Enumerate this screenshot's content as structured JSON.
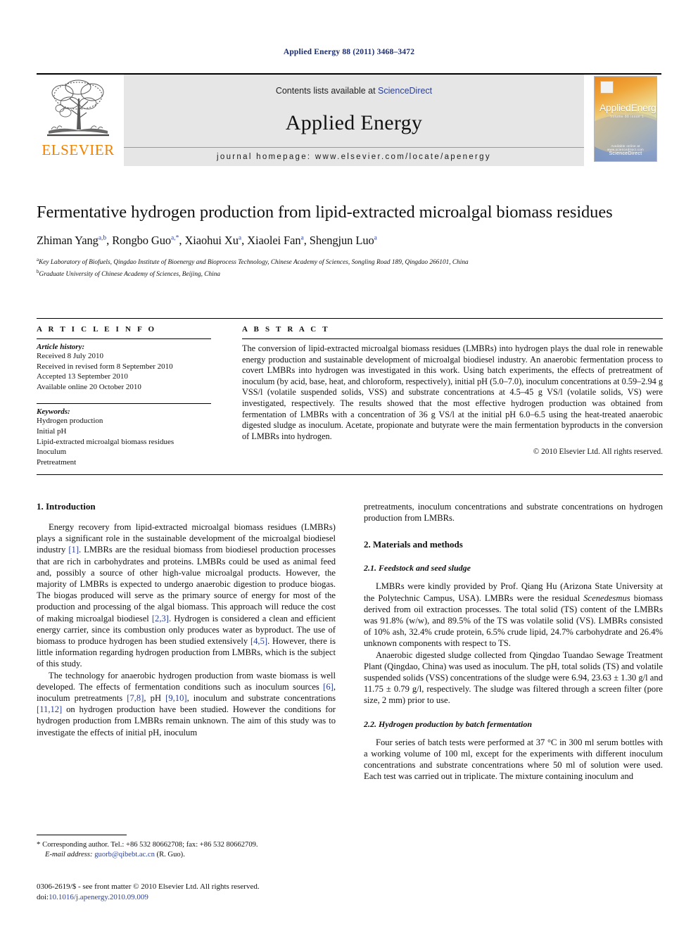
{
  "running_head": "Applied Energy 88 (2011) 3468–3472",
  "masthead": {
    "publisher_name": "ELSEVIER",
    "contents_prefix": "Contents lists available at ",
    "sciencedirect": "ScienceDirect",
    "journal_title": "Applied Energy",
    "homepage": "journal homepage: www.elsevier.com/locate/apenergy",
    "cover": {
      "title_part1": "Applied",
      "title_part2": "Energy",
      "subtitle": "Volume 88  Issue 1",
      "footer_small": "Available online at www.sciencedirect.com",
      "footer_big": "ScienceDirect"
    }
  },
  "article": {
    "title": "Fermentative hydrogen production from lipid-extracted microalgal biomass residues",
    "authors": [
      {
        "name": "Zhiman Yang",
        "sup": "a,b",
        "sep": ", "
      },
      {
        "name": "Rongbo Guo",
        "sup": "a,*",
        "sep": ", "
      },
      {
        "name": "Xiaohui Xu",
        "sup": "a",
        "sep": ", "
      },
      {
        "name": "Xiaolei Fan",
        "sup": "a",
        "sep": ", "
      },
      {
        "name": "Shengjun Luo",
        "sup": "a",
        "sep": ""
      }
    ],
    "affiliations": [
      {
        "marker": "a",
        "text": "Key Laboratory of Biofuels, Qingdao Institute of Bioenergy and Bioprocess Technology, Chinese Academy of Sciences, Songling Road 189, Qingdao 266101, China"
      },
      {
        "marker": "b",
        "text": "Graduate University of Chinese Academy of Sciences, Beijing, China"
      }
    ]
  },
  "article_info": {
    "heading": "A R T I C L E   I N F O",
    "history_label": "Article history:",
    "history": [
      "Received 8 July 2010",
      "Received in revised form 8 September 2010",
      "Accepted 13 September 2010",
      "Available online 20 October 2010"
    ],
    "keywords_label": "Keywords:",
    "keywords": [
      "Hydrogen production",
      "Initial pH",
      "Lipid-extracted microalgal biomass residues",
      "Inoculum",
      "Pretreatment"
    ]
  },
  "abstract": {
    "heading": "A B S T R A C T",
    "text": "The conversion of lipid-extracted microalgal biomass residues (LMBRs) into hydrogen plays the dual role in renewable energy production and sustainable development of microalgal biodiesel industry. An anaerobic fermentation process to covert LMBRs into hydrogen was investigated in this work. Using batch experiments, the effects of pretreatment of inoculum (by acid, base, heat, and chloroform, respectively), initial pH (5.0–7.0), inoculum concentrations at 0.59–2.94 g VSS/l (volatile suspended solids, VSS) and substrate concentrations at 4.5–45 g VS/l (volatile solids, VS) were investigated, respectively. The results showed that the most effective hydrogen production was obtained from fermentation of LMBRs with a concentration of 36 g VS/l at the initial pH 6.0–6.5 using the heat-treated anaerobic digested sludge as inoculum. Acetate, propionate and butyrate were the main fermentation byproducts in the conversion of LMBRs into hydrogen.",
    "copyright": "© 2010 Elsevier Ltd. All rights reserved."
  },
  "sections": {
    "introduction_heading": "1. Introduction",
    "intro_p1_a": "Energy recovery from lipid-extracted microalgal biomass residues (LMBRs) plays a significant role in the sustainable development of the microalgal biodiesel industry ",
    "intro_cite1": "[1]",
    "intro_p1_b": ". LMBRs are the residual biomass from biodiesel production processes that are rich in carbohydrates and proteins. LMBRs could be used as animal feed and, possibly a source of other high-value microalgal products. However, the majority of LMBRs is expected to undergo anaerobic digestion to produce biogas. The biogas produced will serve as the primary source of energy for most of the production and processing of the algal biomass. This approach will reduce the cost of making microalgal biodiesel ",
    "intro_cite2": "[2,3]",
    "intro_p1_c": ". Hydrogen is considered a clean and efficient energy carrier, since its combustion only produces water as byproduct. The use of biomass to produce hydrogen has been studied extensively ",
    "intro_cite3": "[4,5]",
    "intro_p1_d": ". However, there is little information regarding hydrogen production from LMBRs, which is the subject of this study.",
    "intro_p2_a": "The technology for anaerobic hydrogen production from waste biomass is well developed. The effects of fermentation conditions such as inoculum sources ",
    "intro_cite4": "[6]",
    "intro_p2_b": ", inoculum pretreatments ",
    "intro_cite5": "[7,8]",
    "intro_p2_c": ", pH ",
    "intro_cite6": "[9,10]",
    "intro_p2_d": ", inoculum and substrate concentrations ",
    "intro_cite7": "[11,12]",
    "intro_p2_e": " on hydrogen production have been studied. However the conditions for hydrogen production from LMBRs remain unknown. The aim of this study was to investigate the effects of initial pH, inoculum pretreatments, inoculum concentrations and substrate concentrations on hydrogen production from LMBRs.",
    "materials_heading": "2. Materials and methods",
    "sub21_heading": "2.1. Feedstock and seed sludge",
    "sub21_p1_a": "LMBRs were kindly provided by Prof. Qiang Hu (Arizona State University at the Polytechnic Campus, USA). LMBRs were the residual ",
    "sub21_p1_italic": "Scenedesmus",
    "sub21_p1_b": " biomass derived from oil extraction processes. The total solid (TS) content of the LMBRs was 91.8% (w/w), and 89.5% of the TS was volatile solid (VS). LMBRs consisted of 10% ash, 32.4% crude protein, 6.5% crude lipid, 24.7% carbohydrate and 26.4% unknown components with respect to TS.",
    "sub21_p2": "Anaerobic digested sludge collected from Qingdao Tuandao Sewage Treatment Plant (Qingdao, China) was used as inoculum. The pH, total solids (TS) and volatile suspended solids (VSS) concentrations of the sludge were 6.94, 23.63 ± 1.30 g/l and 11.75 ± 0.79 g/l, respectively. The sludge was filtered through a screen filter (pore size, 2 mm) prior to use.",
    "sub22_heading": "2.2. Hydrogen production by batch fermentation",
    "sub22_p1": "Four series of batch tests were performed at 37 °C in 300 ml serum bottles with a working volume of 100 ml, except for the experiments with different inoculum concentrations and substrate concentrations where 50 ml of solution were used. Each test was carried out in triplicate. The mixture containing inoculum and"
  },
  "footnote": {
    "star": "*",
    "corresponding": " Corresponding author. Tel.: +86 532 80662708; fax: +86 532 80662709.",
    "email_label": "E-mail address:",
    "email": "guorb@qibebt.ac.cn",
    "email_suffix": " (R. Guo)."
  },
  "footer": {
    "issn_line": "0306-2619/$ - see front matter © 2010 Elsevier Ltd. All rights reserved.",
    "doi_label": "doi:",
    "doi": "10.1016/j.apenergy.2010.09.009"
  },
  "colors": {
    "link_blue": "#2b3f96",
    "running_head_blue": "#1a2b6d",
    "elsevier_orange": "#F08000",
    "band_gray": "#e6e6e6"
  }
}
